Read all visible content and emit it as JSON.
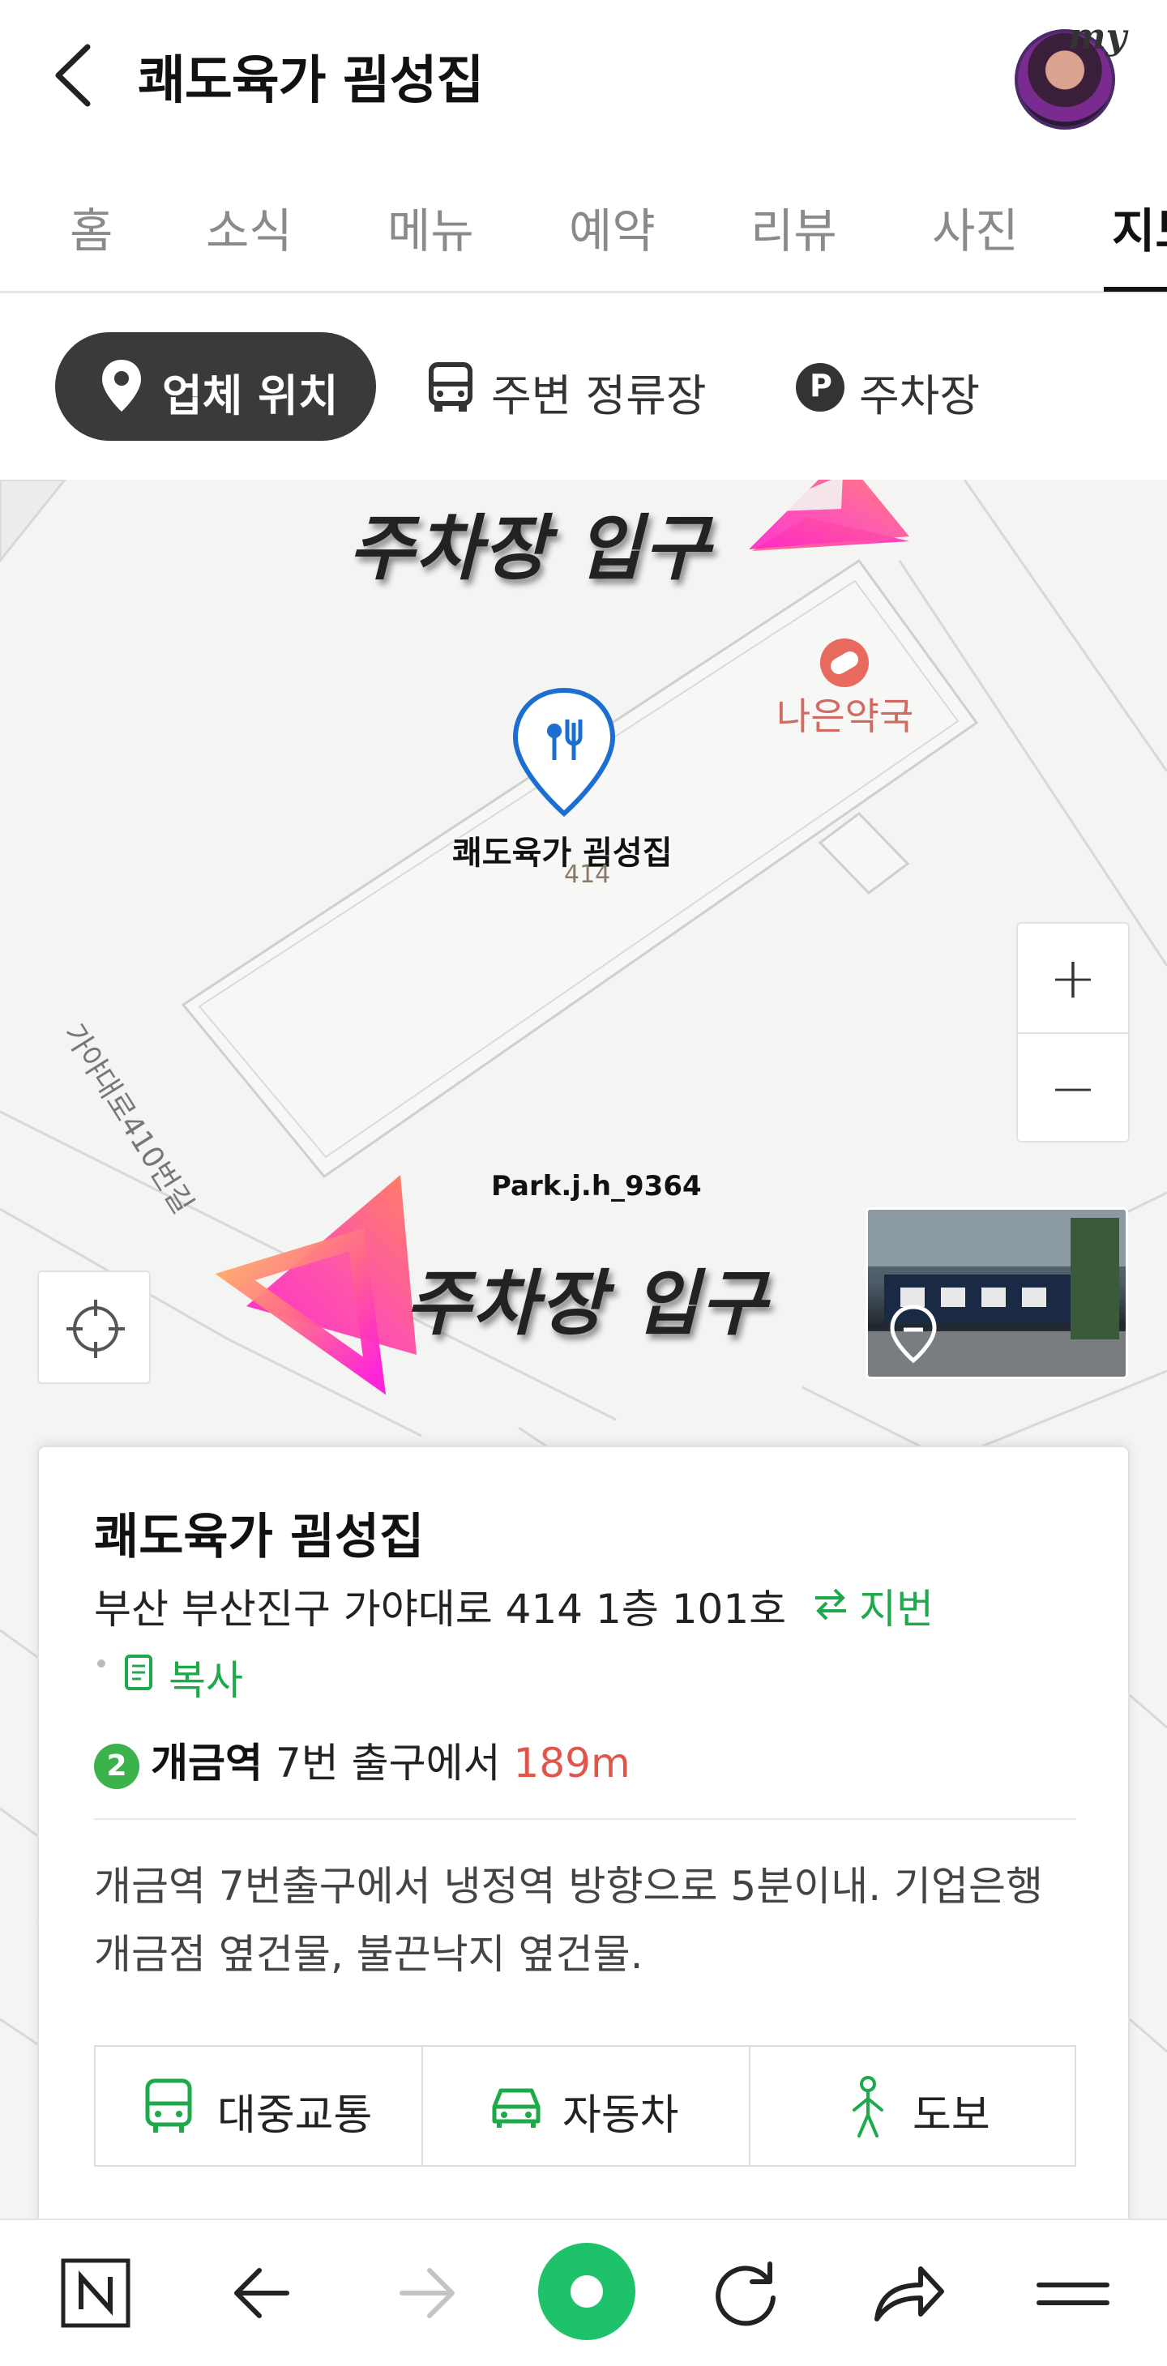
{
  "header": {
    "title": "쾌도육가 굄성집",
    "avatar_badge": "my"
  },
  "tabs": [
    {
      "label": "홈"
    },
    {
      "label": "소식"
    },
    {
      "label": "메뉴"
    },
    {
      "label": "예약"
    },
    {
      "label": "리뷰"
    },
    {
      "label": "사진"
    },
    {
      "label": "지도",
      "active": true
    }
  ],
  "filters": {
    "location": "업체 위치",
    "bus_stops": "주변 정류장",
    "parking": "주차장",
    "parking_icon_letter": "P"
  },
  "map": {
    "overlay_top": "주차장 입구",
    "overlay_bottom": "주차장 입구",
    "poi_pharmacy": "나은약국",
    "marker_name": "쾌도육가 굄성집",
    "marker_number": "414",
    "road_name": "가야대로410번길",
    "user_tag": "Park.j.h_9364",
    "zoom_in": "+",
    "zoom_out": "−"
  },
  "card": {
    "title": "쾌도육가 굄성집",
    "address": "부산 부산진구 가야대로 414 1층 101호",
    "lot_link": "지번",
    "copy_link": "복사",
    "subway_line": "2",
    "subway_station": "개금역",
    "subway_exit": "7번 출구에서",
    "subway_distance": "189m",
    "description": "개금역 7번출구에서 냉정역 방향으로 5분이내. 기업은행 개금점 옆건물, 불끈낙지 옆건물.",
    "routes": [
      "대중교통",
      "자동차",
      "도보"
    ]
  },
  "colors": {
    "accent_green": "#1ea94a",
    "distance_red": "#e0564a",
    "nav_green": "#1ec26a"
  }
}
